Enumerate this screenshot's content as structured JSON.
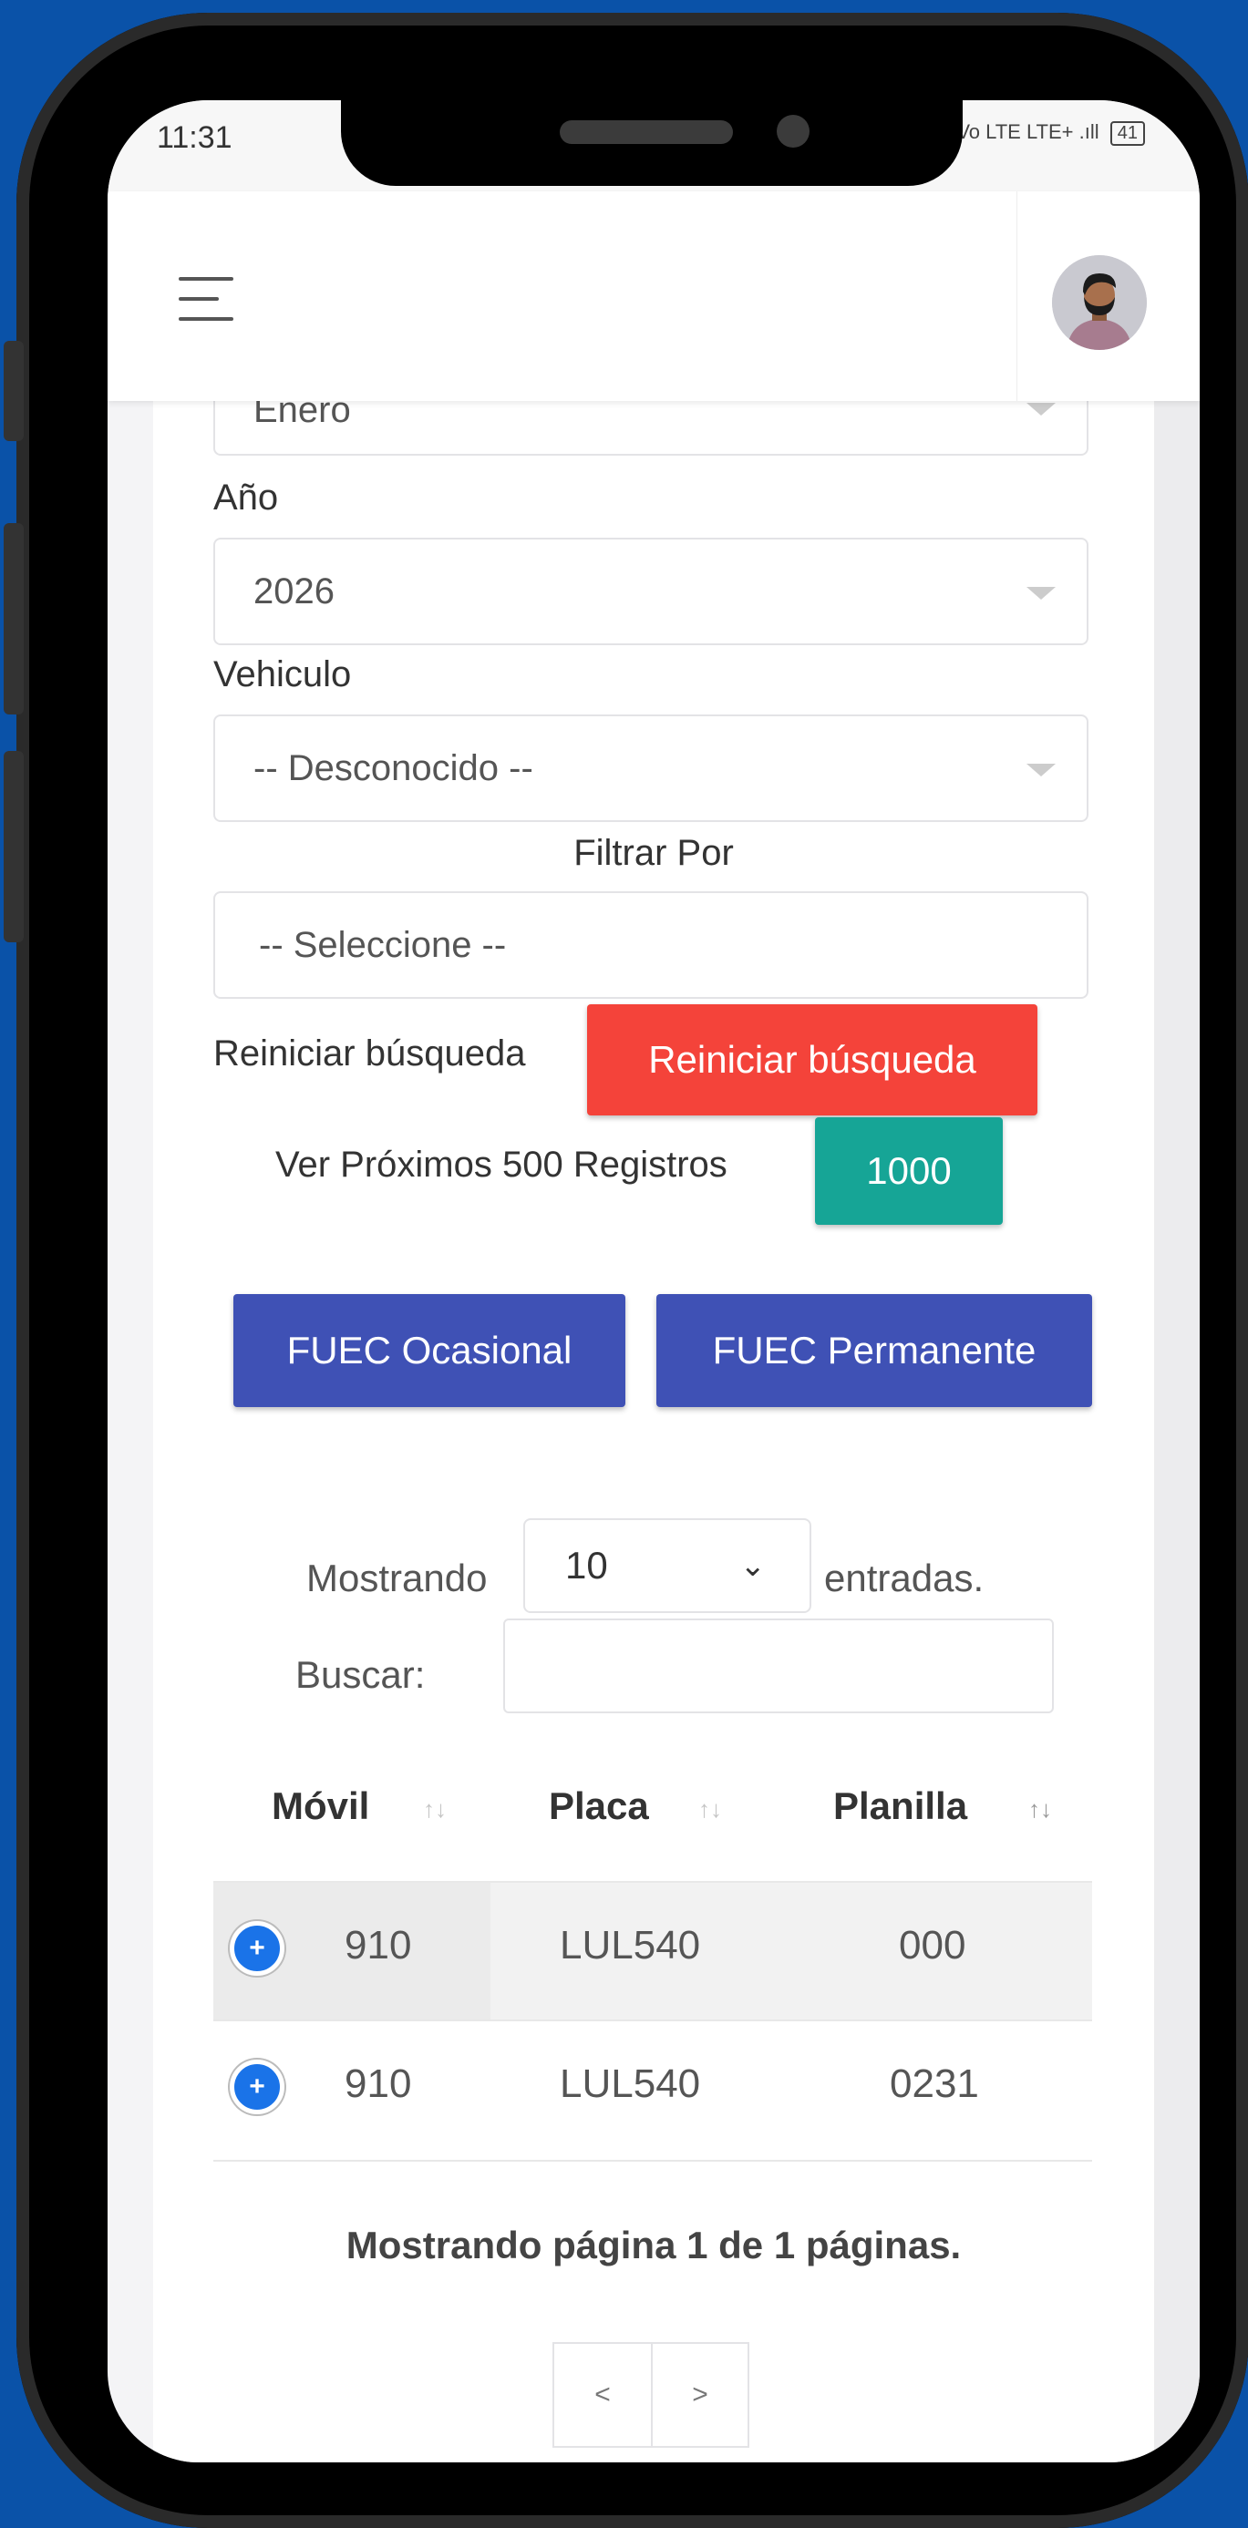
{
  "status": {
    "time": "11:31",
    "indicators": "Vo LTE LTE+ .ıll",
    "battery": "41"
  },
  "form": {
    "mes_value": "Enero",
    "anio_label": "Año",
    "anio_value": "2026",
    "vehiculo_label": "Vehiculo",
    "vehiculo_value": "-- Desconocido --",
    "filtrar_label": "Filtrar Por",
    "filtrar_value": "-- Seleccione --",
    "reiniciar_text": "Reiniciar búsqueda",
    "reiniciar_button": "Reiniciar búsqueda",
    "proximos_text": "Ver Próximos 500 Registros",
    "proximos_button": "1000",
    "fuec_ocasional": "FUEC Ocasional",
    "fuec_permanente": "FUEC Permanente"
  },
  "table_controls": {
    "mostrando_label": "Mostrando",
    "entries_value": "10",
    "entradas_label": "entradas.",
    "buscar_label": "Buscar:",
    "buscar_value": ""
  },
  "table": {
    "headers": [
      "Móvil",
      "Placa",
      "Planilla"
    ],
    "rows": [
      {
        "movil": "910",
        "placa": "LUL540",
        "planilla": "000"
      },
      {
        "movil": "910",
        "placa": "LUL540",
        "planilla": "0231"
      }
    ]
  },
  "pagination": {
    "info": "Mostrando página 1 de 1 páginas.",
    "prev": "<",
    "next": ">"
  },
  "colors": {
    "background": "#0a52a8",
    "danger": "#f4433a",
    "teal": "#16a596",
    "indigo": "#3f51b5",
    "expand": "#1a73e8"
  }
}
